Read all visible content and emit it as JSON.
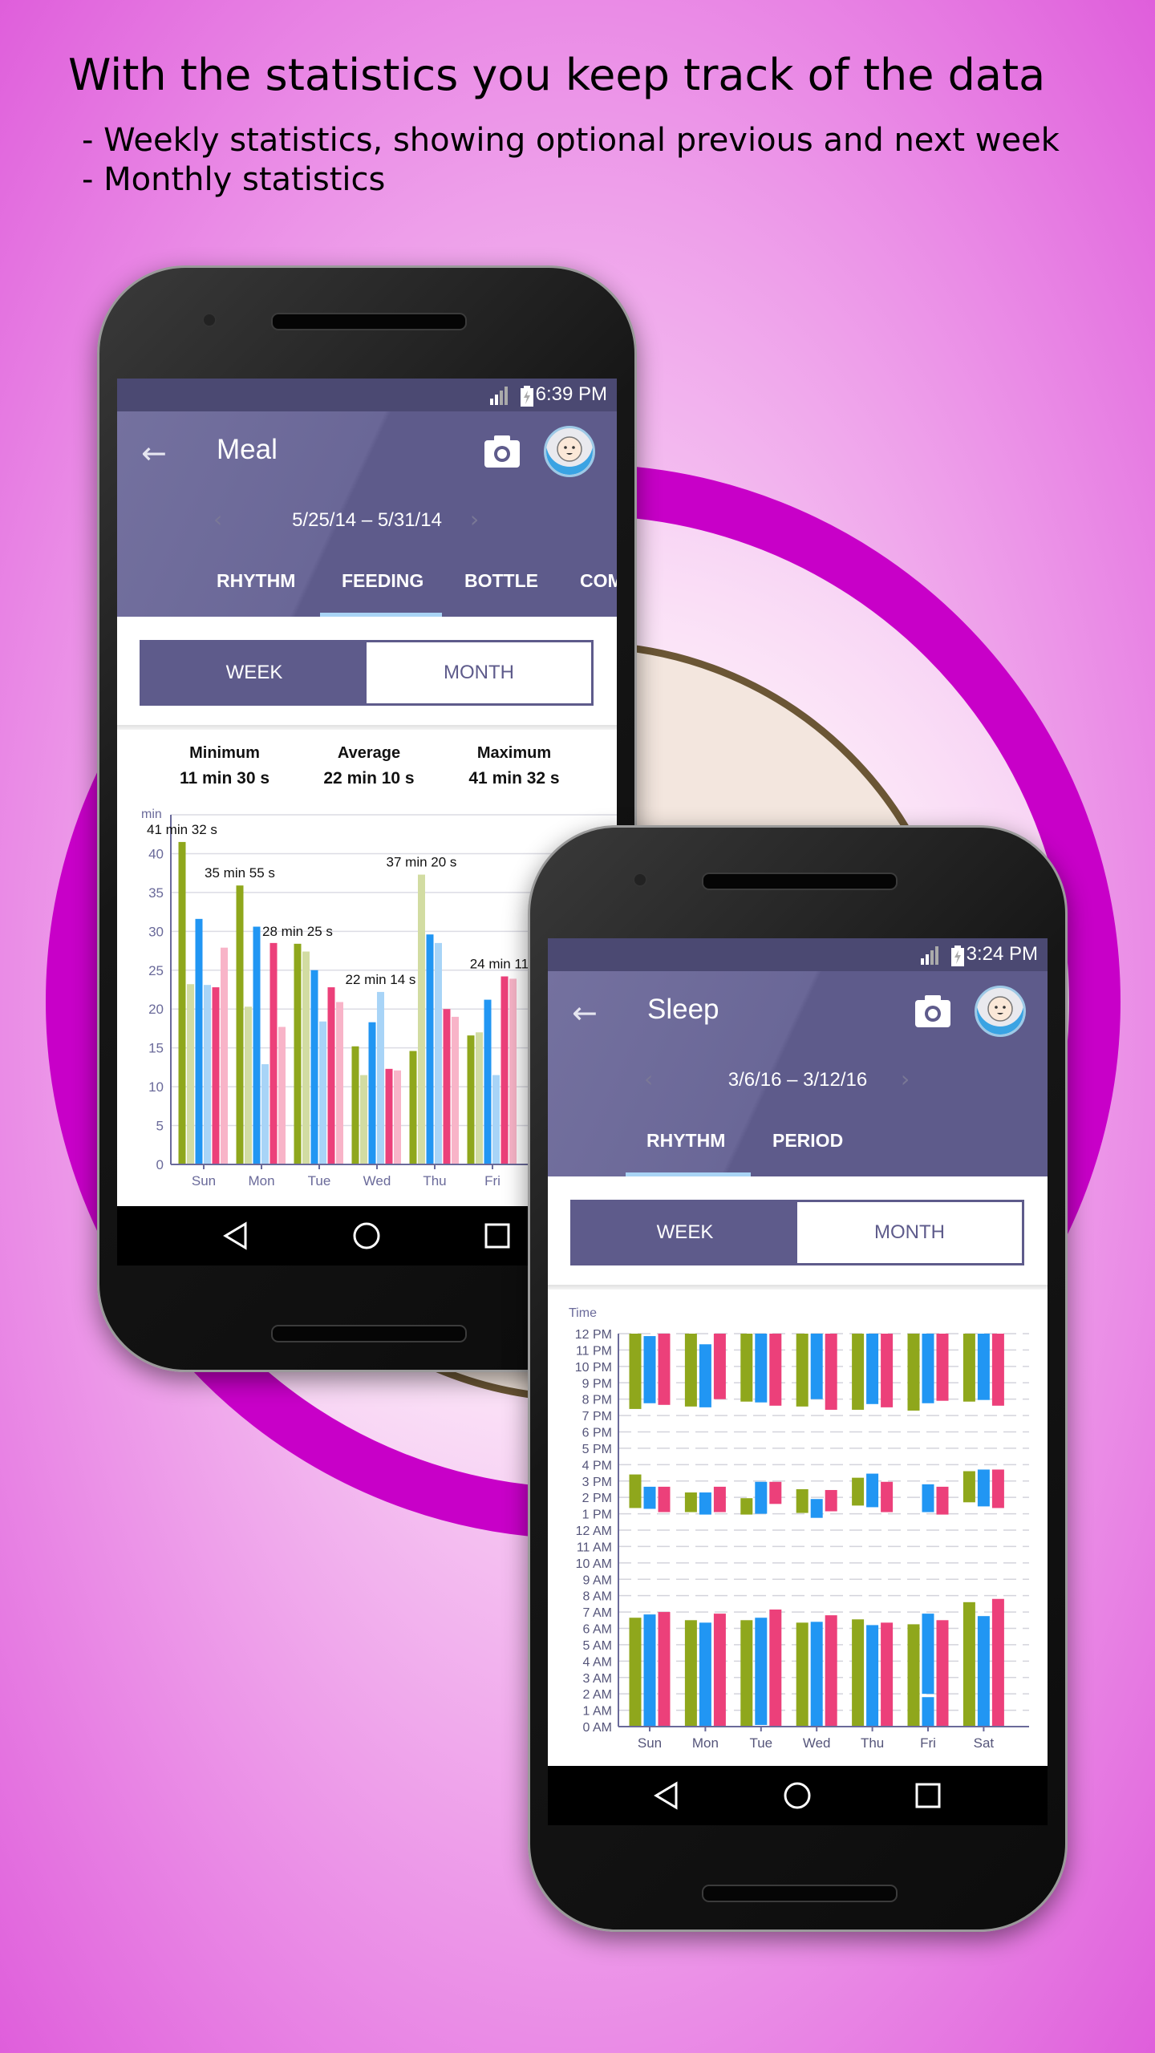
{
  "headline": "With the statistics you keep track of the data",
  "bullets": [
    "- Weekly statistics, showing optional previous and next week",
    "- Monthly statistics"
  ],
  "colors": {
    "ring": "#c800c8",
    "appbar": "#5e5b8b",
    "indicator": "#a9d4f5"
  },
  "meal_screen": {
    "status_time": "6:39 PM",
    "title": "Meal",
    "back_icon": "arrow-left-icon",
    "camera_icon": "camera-icon",
    "date_range": "5/25/14 – 5/31/14",
    "tabs": [
      {
        "label": "RHYTHM"
      },
      {
        "label": "FEEDING",
        "active": true
      },
      {
        "label": "BOTTLE"
      },
      {
        "label": "COM"
      }
    ],
    "toggle": {
      "week": "WEEK",
      "month": "MONTH",
      "selected": "WEEK"
    },
    "stats": [
      {
        "label": "Minimum",
        "value": "11 min 30 s"
      },
      {
        "label": "Average",
        "value": "22 min 10 s"
      },
      {
        "label": "Maximum",
        "value": "41 min 32 s"
      }
    ]
  },
  "sleep_screen": {
    "status_time": "3:24 PM",
    "title": "Sleep",
    "back_icon": "arrow-left-icon",
    "camera_icon": "camera-icon",
    "date_range": "3/6/16 – 3/12/16",
    "tabs": [
      {
        "label": "RHYTHM",
        "active": true
      },
      {
        "label": "PERIOD"
      }
    ],
    "toggle": {
      "week": "WEEK",
      "month": "MONTH",
      "selected": "WEEK"
    }
  },
  "chart_data": [
    {
      "type": "bar",
      "ylabel": "min",
      "ylim": [
        0,
        45
      ],
      "yticks": [
        0,
        5,
        10,
        15,
        20,
        25,
        30,
        35,
        40
      ],
      "grid": true,
      "categories": [
        "Sun",
        "Mon",
        "Tue",
        "Wed",
        "Thu",
        "Fri"
      ],
      "series": [
        {
          "color": "#8fa71c",
          "values": [
            41.5,
            35.9,
            28.4,
            15.2,
            14.6,
            16.6
          ]
        },
        {
          "color": "#d2dca2",
          "values": [
            23.2,
            20.3,
            27.4,
            11.5,
            37.3,
            17.0
          ]
        },
        {
          "color": "#2196f3",
          "values": [
            31.6,
            30.6,
            25.0,
            18.3,
            29.6,
            21.2
          ]
        },
        {
          "color": "#a8d4f7",
          "values": [
            23.1,
            12.9,
            18.4,
            22.2,
            28.5,
            11.5
          ]
        },
        {
          "color": "#ec407a",
          "values": [
            22.8,
            28.5,
            22.8,
            12.3,
            20.0,
            24.2
          ]
        },
        {
          "color": "#f8b4c8",
          "values": [
            27.9,
            17.7,
            20.9,
            12.1,
            19.0,
            23.9
          ]
        }
      ],
      "data_labels": [
        {
          "day": 0,
          "series": 0,
          "text": "41 min 32 s"
        },
        {
          "day": 1,
          "series": 0,
          "text": "35 min 55 s"
        },
        {
          "day": 2,
          "series": 0,
          "text": "28 min 25 s"
        },
        {
          "day": 3,
          "series": 3,
          "text": "22 min 14 s"
        },
        {
          "day": 4,
          "series": 1,
          "text": "37 min 20 s"
        },
        {
          "day": 5,
          "series": 4,
          "text": "24 min 11 s"
        }
      ]
    },
    {
      "type": "bar",
      "ylabel": "Time",
      "ylim": [
        0,
        24
      ],
      "ytick_labels": [
        "0 AM",
        "1 AM",
        "2 AM",
        "3 AM",
        "4 AM",
        "5 AM",
        "6 AM",
        "7 AM",
        "8 AM",
        "9 AM",
        "10 AM",
        "11 AM",
        "12 AM",
        "1 PM",
        "2 PM",
        "3 PM",
        "4 PM",
        "5 PM",
        "6 PM",
        "7 PM",
        "8 PM",
        "9 PM",
        "10 PM",
        "11 PM",
        "12 PM"
      ],
      "grid": true,
      "categories": [
        "Sun",
        "Mon",
        "Tue",
        "Wed",
        "Thu",
        "Fri",
        "Sat"
      ],
      "series": [
        {
          "color": "#8fa71c",
          "segments": [
            [
              [
                0,
                6.65
              ],
              [
                13.35,
                15.4
              ],
              [
                19.4,
                24
              ]
            ],
            [
              [
                0,
                6.5
              ],
              [
                13.1,
                14.3
              ],
              [
                19.55,
                24
              ]
            ],
            [
              [
                0,
                6.5
              ],
              [
                12.95,
                13.95
              ],
              [
                19.85,
                24
              ]
            ],
            [
              [
                0,
                6.35
              ],
              [
                13.05,
                14.5
              ],
              [
                19.55,
                24
              ]
            ],
            [
              [
                0,
                6.55
              ],
              [
                13.5,
                15.2
              ],
              [
                19.35,
                24
              ]
            ],
            [
              [
                0,
                6.25
              ],
              [
                19.3,
                24
              ]
            ],
            [
              [
                0,
                7.6
              ],
              [
                13.7,
                15.6
              ],
              [
                19.85,
                24
              ]
            ]
          ]
        },
        {
          "color": "#2196f3",
          "segments": [
            [
              [
                0,
                6.85
              ],
              [
                13.3,
                14.65
              ],
              [
                19.75,
                23.85
              ]
            ],
            [
              [
                0.05,
                6.35
              ],
              [
                12.95,
                14.3
              ],
              [
                19.5,
                23.35
              ]
            ],
            [
              [
                0.1,
                6.65
              ],
              [
                13.0,
                14.95
              ],
              [
                19.8,
                24
              ]
            ],
            [
              [
                0,
                6.4
              ],
              [
                12.75,
                13.9
              ],
              [
                20.0,
                24
              ]
            ],
            [
              [
                0,
                6.2
              ],
              [
                13.4,
                15.45
              ],
              [
                19.7,
                24
              ]
            ],
            [
              [
                0,
                1.8
              ],
              [
                2.0,
                6.9
              ],
              [
                13.1,
                14.8
              ],
              [
                19.75,
                24
              ]
            ],
            [
              [
                0,
                6.75
              ],
              [
                13.45,
                15.7
              ],
              [
                19.95,
                24
              ]
            ]
          ]
        },
        {
          "color": "#ec407a",
          "segments": [
            [
              [
                0,
                7.0
              ],
              [
                13.1,
                14.65
              ],
              [
                19.65,
                24
              ]
            ],
            [
              [
                0,
                6.9
              ],
              [
                13.1,
                14.65
              ],
              [
                20.0,
                24
              ]
            ],
            [
              [
                0,
                7.15
              ],
              [
                13.6,
                14.95
              ],
              [
                19.6,
                24
              ]
            ],
            [
              [
                0,
                6.8
              ],
              [
                13.15,
                14.45
              ],
              [
                19.35,
                24
              ]
            ],
            [
              [
                0,
                6.35
              ],
              [
                13.1,
                14.95
              ],
              [
                19.5,
                24
              ]
            ],
            [
              [
                0,
                6.5
              ],
              [
                12.95,
                14.65
              ],
              [
                19.9,
                24
              ]
            ],
            [
              [
                0,
                7.8
              ],
              [
                13.35,
                15.7
              ],
              [
                19.6,
                24
              ]
            ]
          ]
        }
      ]
    }
  ]
}
